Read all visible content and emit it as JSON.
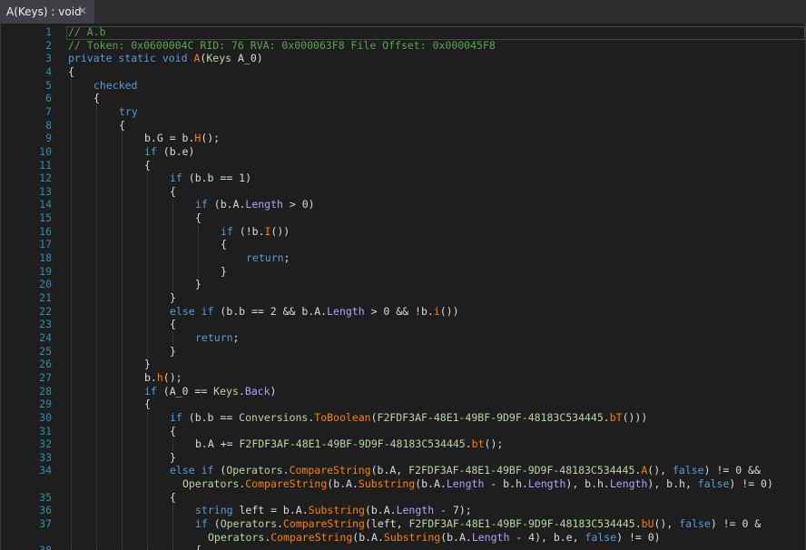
{
  "tab": {
    "title": "A(Keys) : void",
    "close_icon": "close-icon"
  },
  "lines": [
    {
      "n": "1",
      "indent": 0,
      "segs": [
        [
          "c",
          "// A.b"
        ]
      ]
    },
    {
      "n": "2",
      "indent": 0,
      "segs": [
        [
          "c",
          "// Token: 0x0600004C RID: 76 RVA: 0x000063F8 File Offset: 0x000045F8"
        ]
      ]
    },
    {
      "n": "3",
      "indent": 0,
      "segs": [
        [
          "k",
          "private static void "
        ],
        [
          "m",
          "A"
        ],
        [
          "d",
          "("
        ],
        [
          "t",
          "Keys"
        ],
        [
          "d",
          " A_0)"
        ]
      ]
    },
    {
      "n": "4",
      "indent": 0,
      "segs": [
        [
          "d",
          "{"
        ]
      ]
    },
    {
      "n": "5",
      "indent": 1,
      "segs": [
        [
          "k",
          "checked"
        ]
      ]
    },
    {
      "n": "6",
      "indent": 1,
      "segs": [
        [
          "d",
          "{"
        ]
      ]
    },
    {
      "n": "7",
      "indent": 2,
      "segs": [
        [
          "k",
          "try"
        ]
      ]
    },
    {
      "n": "8",
      "indent": 2,
      "segs": [
        [
          "d",
          "{"
        ]
      ]
    },
    {
      "n": "9",
      "indent": 3,
      "segs": [
        [
          "d",
          "b.G = b."
        ],
        [
          "m",
          "H"
        ],
        [
          "d",
          "();"
        ]
      ]
    },
    {
      "n": "10",
      "indent": 3,
      "segs": [
        [
          "k",
          "if"
        ],
        [
          "d",
          " (b.e)"
        ]
      ]
    },
    {
      "n": "11",
      "indent": 3,
      "segs": [
        [
          "d",
          "{"
        ]
      ]
    },
    {
      "n": "12",
      "indent": 4,
      "segs": [
        [
          "k",
          "if"
        ],
        [
          "d",
          " (b.b == 1)"
        ]
      ]
    },
    {
      "n": "13",
      "indent": 4,
      "segs": [
        [
          "d",
          "{"
        ]
      ]
    },
    {
      "n": "14",
      "indent": 5,
      "segs": [
        [
          "k",
          "if"
        ],
        [
          "d",
          " (b.A."
        ],
        [
          "p",
          "Length"
        ],
        [
          "d",
          " > 0)"
        ]
      ]
    },
    {
      "n": "15",
      "indent": 5,
      "segs": [
        [
          "d",
          "{"
        ]
      ]
    },
    {
      "n": "16",
      "indent": 6,
      "segs": [
        [
          "k",
          "if"
        ],
        [
          "d",
          " (!b."
        ],
        [
          "m",
          "I"
        ],
        [
          "d",
          "())"
        ]
      ]
    },
    {
      "n": "17",
      "indent": 6,
      "segs": [
        [
          "d",
          "{"
        ]
      ]
    },
    {
      "n": "18",
      "indent": 7,
      "segs": [
        [
          "k",
          "return"
        ],
        [
          "d",
          ";"
        ]
      ]
    },
    {
      "n": "19",
      "indent": 6,
      "segs": [
        [
          "d",
          "}"
        ]
      ]
    },
    {
      "n": "20",
      "indent": 5,
      "segs": [
        [
          "d",
          "}"
        ]
      ]
    },
    {
      "n": "21",
      "indent": 4,
      "segs": [
        [
          "d",
          "}"
        ]
      ]
    },
    {
      "n": "22",
      "indent": 4,
      "segs": [
        [
          "k",
          "else if"
        ],
        [
          "d",
          " (b.b == 2 && b.A."
        ],
        [
          "p",
          "Length"
        ],
        [
          "d",
          " > 0 && !b."
        ],
        [
          "m",
          "i"
        ],
        [
          "d",
          "())"
        ]
      ]
    },
    {
      "n": "23",
      "indent": 4,
      "segs": [
        [
          "d",
          "{"
        ]
      ]
    },
    {
      "n": "24",
      "indent": 5,
      "segs": [
        [
          "k",
          "return"
        ],
        [
          "d",
          ";"
        ]
      ]
    },
    {
      "n": "25",
      "indent": 4,
      "segs": [
        [
          "d",
          "}"
        ]
      ]
    },
    {
      "n": "26",
      "indent": 3,
      "segs": [
        [
          "d",
          "}"
        ]
      ]
    },
    {
      "n": "27",
      "indent": 3,
      "segs": [
        [
          "d",
          "b."
        ],
        [
          "m",
          "h"
        ],
        [
          "d",
          "();"
        ]
      ]
    },
    {
      "n": "28",
      "indent": 3,
      "segs": [
        [
          "k",
          "if"
        ],
        [
          "d",
          " (A_0 == "
        ],
        [
          "t",
          "Keys"
        ],
        [
          "d",
          "."
        ],
        [
          "p",
          "Back"
        ],
        [
          "d",
          ")"
        ]
      ]
    },
    {
      "n": "29",
      "indent": 3,
      "segs": [
        [
          "d",
          "{"
        ]
      ]
    },
    {
      "n": "30",
      "indent": 4,
      "segs": [
        [
          "k",
          "if"
        ],
        [
          "d",
          " (b.b == "
        ],
        [
          "t",
          "Conversions"
        ],
        [
          "d",
          "."
        ],
        [
          "m",
          "ToBoolean"
        ],
        [
          "d",
          "("
        ],
        [
          "t",
          "F2FDF3AF-48E1-49BF-9D9F-48183C534445"
        ],
        [
          "d",
          "."
        ],
        [
          "m",
          "bT"
        ],
        [
          "d",
          "()))"
        ]
      ]
    },
    {
      "n": "31",
      "indent": 4,
      "segs": [
        [
          "d",
          "{"
        ]
      ]
    },
    {
      "n": "32",
      "indent": 5,
      "segs": [
        [
          "d",
          "b.A += "
        ],
        [
          "t",
          "F2FDF3AF-48E1-49BF-9D9F-48183C534445"
        ],
        [
          "d",
          "."
        ],
        [
          "m",
          "bt"
        ],
        [
          "d",
          "();"
        ]
      ]
    },
    {
      "n": "33",
      "indent": 4,
      "segs": [
        [
          "d",
          "}"
        ]
      ]
    },
    {
      "n": "34",
      "indent": 4,
      "segs": [
        [
          "k",
          "else if"
        ],
        [
          "d",
          " ("
        ],
        [
          "t",
          "Operators"
        ],
        [
          "d",
          "."
        ],
        [
          "m",
          "CompareString"
        ],
        [
          "d",
          "(b.A, "
        ],
        [
          "t",
          "F2FDF3AF-48E1-49BF-9D9F-48183C534445"
        ],
        [
          "d",
          "."
        ],
        [
          "m",
          "A"
        ],
        [
          "d",
          "(), "
        ],
        [
          "k",
          "false"
        ],
        [
          "d",
          ") != 0 &&"
        ]
      ]
    },
    {
      "n": "",
      "indent": 4,
      "extra": 2,
      "segs": [
        [
          "t",
          "Operators"
        ],
        [
          "d",
          "."
        ],
        [
          "m",
          "CompareString"
        ],
        [
          "d",
          "(b.A."
        ],
        [
          "m",
          "Substring"
        ],
        [
          "d",
          "(b.A."
        ],
        [
          "p",
          "Length"
        ],
        [
          "d",
          " - b.h."
        ],
        [
          "p",
          "Length"
        ],
        [
          "d",
          "), b.h."
        ],
        [
          "p",
          "Length"
        ],
        [
          "d",
          "), b.h, "
        ],
        [
          "k",
          "false"
        ],
        [
          "d",
          ") != 0)"
        ]
      ]
    },
    {
      "n": "35",
      "indent": 4,
      "segs": [
        [
          "d",
          "{"
        ]
      ]
    },
    {
      "n": "36",
      "indent": 5,
      "segs": [
        [
          "k",
          "string"
        ],
        [
          "d",
          " left = b.A."
        ],
        [
          "m",
          "Substring"
        ],
        [
          "d",
          "(b.A."
        ],
        [
          "p",
          "Length"
        ],
        [
          "d",
          " - 7);"
        ]
      ]
    },
    {
      "n": "37",
      "indent": 5,
      "segs": [
        [
          "k",
          "if"
        ],
        [
          "d",
          " ("
        ],
        [
          "t",
          "Operators"
        ],
        [
          "d",
          "."
        ],
        [
          "m",
          "CompareString"
        ],
        [
          "d",
          "(left, "
        ],
        [
          "t",
          "F2FDF3AF-48E1-49BF-9D9F-48183C534445"
        ],
        [
          "d",
          "."
        ],
        [
          "m",
          "bU"
        ],
        [
          "d",
          "(), "
        ],
        [
          "k",
          "false"
        ],
        [
          "d",
          ") != 0 &"
        ]
      ]
    },
    {
      "n": "",
      "indent": 5,
      "extra": 2,
      "segs": [
        [
          "t",
          "Operators"
        ],
        [
          "d",
          "."
        ],
        [
          "m",
          "CompareString"
        ],
        [
          "d",
          "(b.A."
        ],
        [
          "m",
          "Substring"
        ],
        [
          "d",
          "(b.A."
        ],
        [
          "p",
          "Length"
        ],
        [
          "d",
          " - 4), b.e, "
        ],
        [
          "k",
          "false"
        ],
        [
          "d",
          ") != 0)"
        ]
      ]
    },
    {
      "n": "38",
      "indent": 5,
      "segs": [
        [
          "d",
          "{"
        ]
      ]
    }
  ]
}
